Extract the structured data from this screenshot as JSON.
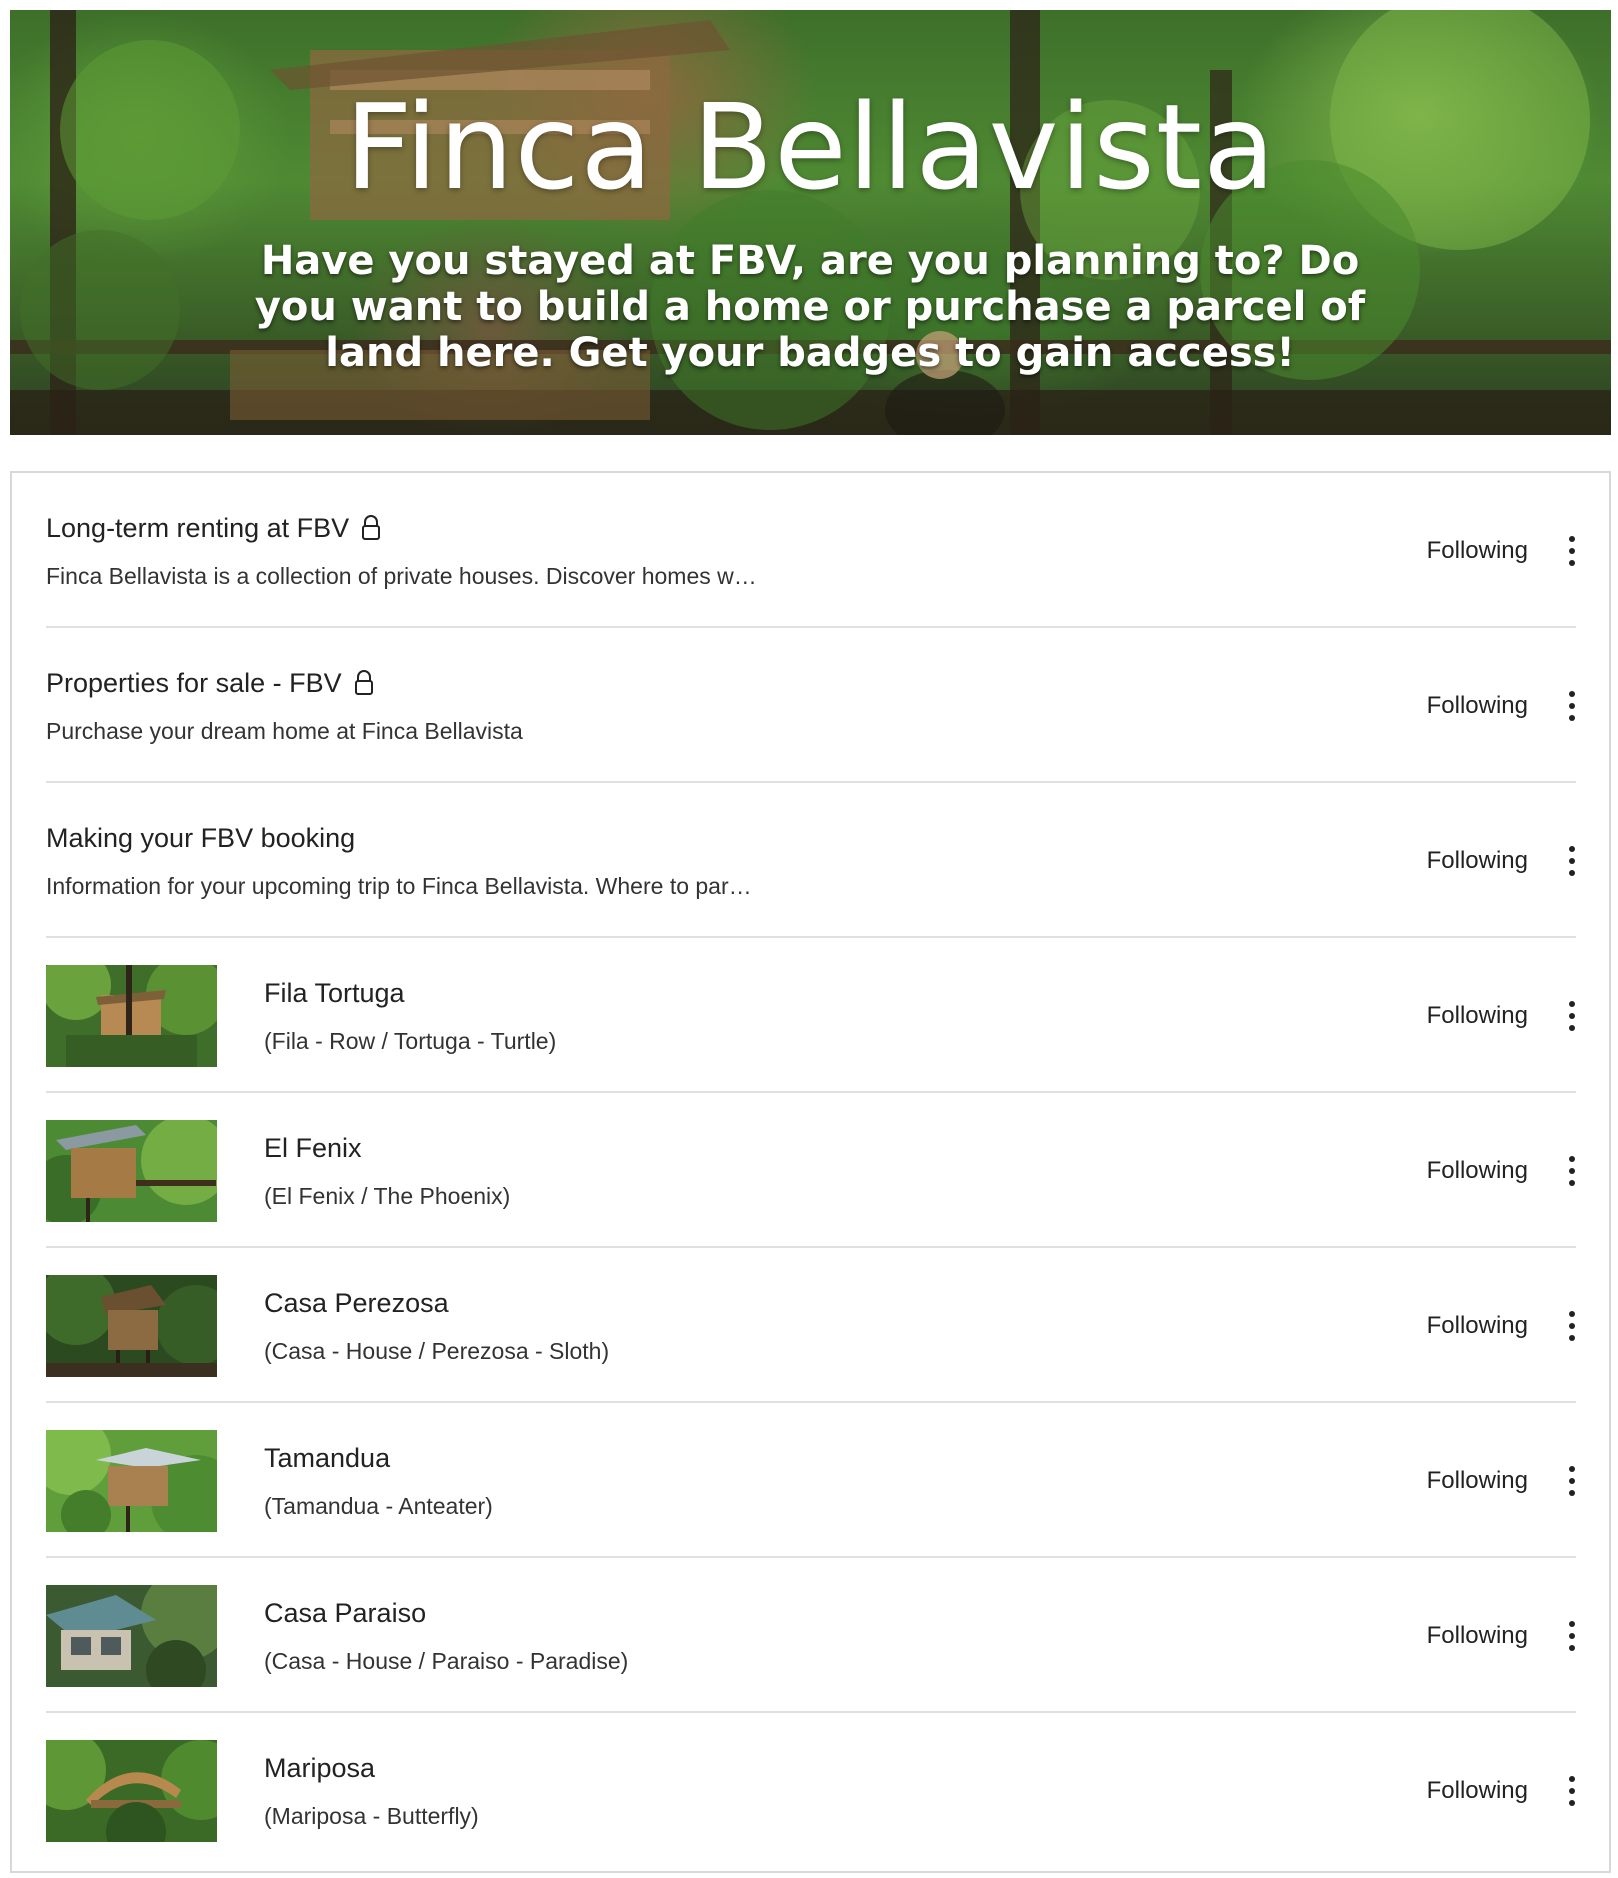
{
  "hero": {
    "title": "Finca Bellavista",
    "subtitle": "Have you stayed at FBV, are you planning to? Do you want to build a home or purchase a parcel of land here. Get your badges to gain access!"
  },
  "icons": {
    "lock": "lock-icon",
    "more": "more-vertical-icon"
  },
  "colors": {
    "divider": "#e0e0e0",
    "border": "#d8d8d8",
    "text": "#222222"
  },
  "items": [
    {
      "title": "Long-term renting at FBV",
      "locked": true,
      "description": "Finca Bellavista is a collection of private houses. Discover homes w…",
      "status": "Following"
    },
    {
      "title": "Properties for sale - FBV",
      "locked": true,
      "description": "Purchase your dream home at Finca Bellavista",
      "status": "Following"
    },
    {
      "title": "Making your FBV booking",
      "locked": false,
      "description": "Information for your upcoming trip to Finca Bellavista. Where to par…",
      "status": "Following"
    },
    {
      "title": "Fila Tortuga",
      "description": "(Fila - Row / Tortuga - Turtle)",
      "status": "Following"
    },
    {
      "title": "El Fenix",
      "description": "(El Fenix / The Phoenix)",
      "status": "Following"
    },
    {
      "title": "Casa Perezosa",
      "description": "(Casa - House / Perezosa - Sloth)",
      "status": "Following"
    },
    {
      "title": "Tamandua",
      "description": "(Tamandua - Anteater)",
      "status": "Following"
    },
    {
      "title": "Casa Paraiso",
      "description": "(Casa - House / Paraiso - Paradise)",
      "status": "Following"
    },
    {
      "title": "Mariposa",
      "description": "(Mariposa - Butterfly)",
      "status": "Following"
    }
  ]
}
